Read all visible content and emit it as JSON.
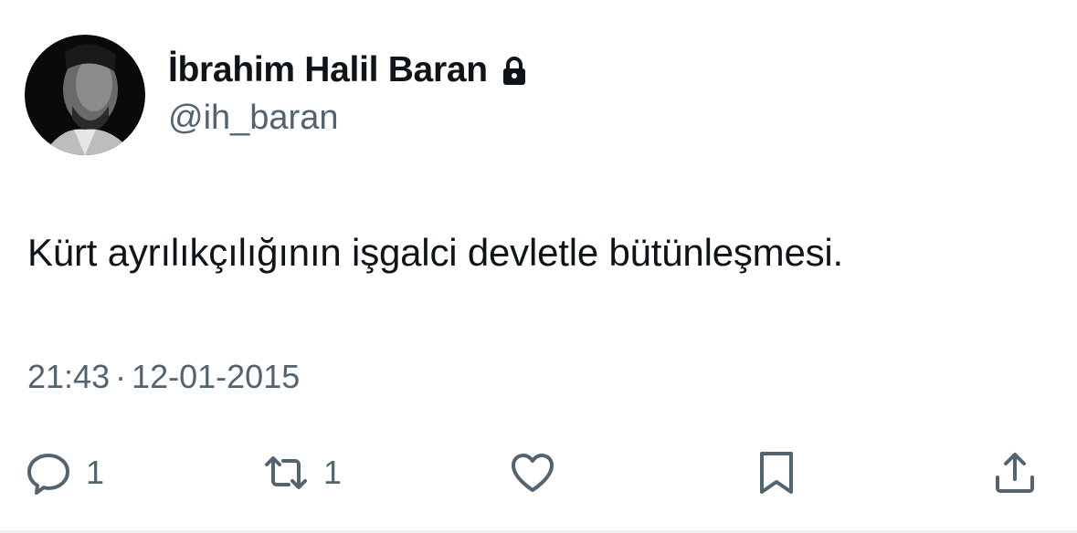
{
  "author": {
    "display_name": "İbrahim Halil Baran",
    "handle": "@ih_baran",
    "avatar_icon": "avatar-photo",
    "protected_icon": "lock-icon"
  },
  "tweet": {
    "text": "Kürt ayrılıkçılığının işgalci devletle bütünleşmesi.",
    "time": "21:43",
    "separator": "·",
    "date": "12-01-2015"
  },
  "actions": {
    "reply": {
      "icon": "reply-icon",
      "count": "1"
    },
    "retweet": {
      "icon": "retweet-icon",
      "count": "1"
    },
    "like": {
      "icon": "heart-icon"
    },
    "bookmark": {
      "icon": "bookmark-icon"
    },
    "share": {
      "icon": "share-icon"
    }
  },
  "colors": {
    "text_primary": "#0f1419",
    "text_secondary": "#536471",
    "icon": "#536471"
  }
}
